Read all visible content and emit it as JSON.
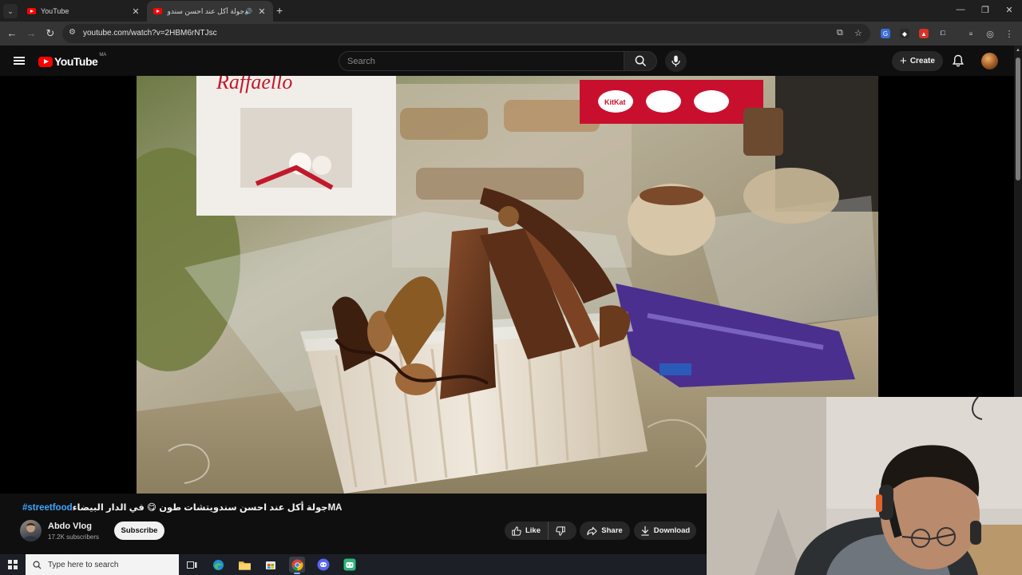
{
  "browser": {
    "tabs": [
      {
        "title": "YouTube",
        "active": false
      },
      {
        "title": "جولة أكل عند احسن سندويتشات طون",
        "active": true
      }
    ],
    "url": "youtube.com/watch?v=2HBM6rNTJsc"
  },
  "masthead": {
    "logo_text": "YouTube",
    "region": "MA",
    "search_placeholder": "Search",
    "create_label": "Create"
  },
  "video": {
    "title_hashtag": "#streetfood",
    "title_arabic": "جولة أكل عند احسن سندويتشات طون 😋 في الدار البيضاءMA",
    "channel_name": "Abdo Vlog",
    "subscribers": "17.2K subscribers",
    "subscribe_label": "Subscribe",
    "like_label": "Like",
    "share_label": "Share",
    "download_label": "Download",
    "scene_text": {
      "box_brand": "Raffaello",
      "wrapper_brand": "KitKat"
    }
  },
  "taskbar": {
    "search_placeholder": "Type here to search"
  },
  "colors": {
    "youtube_red": "#ff0000",
    "background": "#0f0f0f",
    "hashtag_blue": "#3ea6ff",
    "pill_bg": "#272727"
  }
}
